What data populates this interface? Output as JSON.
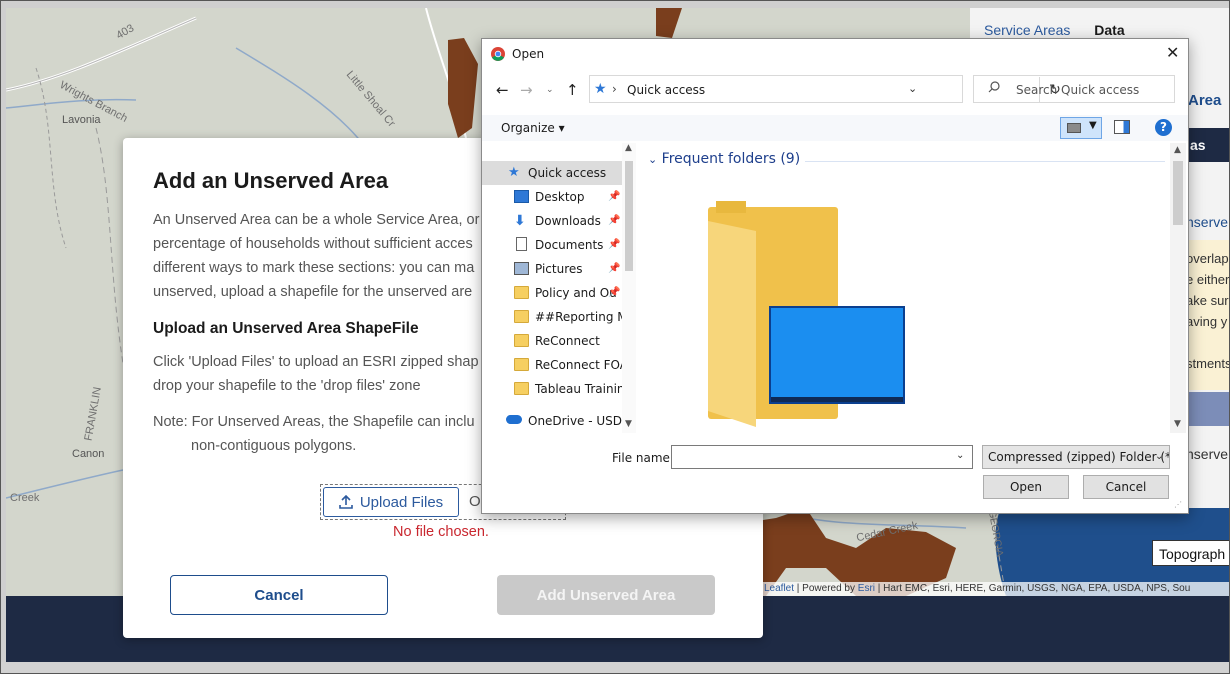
{
  "map": {
    "labels": {
      "route": "403",
      "wrights_branch": "Wrights Branch",
      "little_shoal": "Little Shoal Cr",
      "lavonia": "Lavonia",
      "franklin": "FRANKLIN",
      "canon": "Canon",
      "creek": "Creek",
      "cedar_creek": "Cedar Creek",
      "georgia": "GEORGIA"
    },
    "layer_select": "Topograph",
    "attribution": {
      "leaflet": "Leaflet",
      "powered": " | Powered by ",
      "esri": "Esri",
      "rest": " | Hart EMC, Esri, HERE, Garmin, USGS, NGA, EPA, USDA, NPS, Sou"
    },
    "colors": {
      "service_area": "#7a3e1d",
      "land": "#d3d6cc",
      "water": "#1f4f8c"
    }
  },
  "side_panel": {
    "tabs": [
      "Service Areas",
      "Data"
    ],
    "area_title": "Area",
    "dark_bar": "as",
    "unserved_1": "nserve",
    "yellow_lines": [
      "overlap",
      "e either",
      "ake sur",
      "aving y",
      "",
      "stments"
    ],
    "unserved_2": "nserve"
  },
  "modal": {
    "title": "Add an Unserved Area",
    "description": [
      "An Unserved Area can be a whole Service Area, or",
      "percentage of households without sufficient acces",
      "different ways to mark these sections: you can ma",
      "unserved, upload a shapefile for the unserved are"
    ],
    "subheading": "Upload an Unserved Area ShapeFile",
    "instructions": [
      "Click 'Upload Files' to upload an ESRI zipped shap",
      "drop your shapefile to the 'drop files' zone"
    ],
    "note": [
      "Note: For Unserved Areas, the Shapefile can inclu",
      "non-contiguous polygons."
    ],
    "upload_label": "Upload Files",
    "or_text": "O",
    "no_file": "No file chosen.",
    "cancel_label": "Cancel",
    "add_label": "Add Unserved Area"
  },
  "open_dialog": {
    "title": "Open",
    "close": "✕",
    "address": "Quick access",
    "search_placeholder": "Search Quick access",
    "organize": "Organize ▾",
    "help": "?",
    "nav_items": [
      {
        "label": "Quick access",
        "icon": "star-icon",
        "pinned": false,
        "selected": true
      },
      {
        "label": "Desktop",
        "icon": "desktop-icon",
        "pinned": true
      },
      {
        "label": "Downloads",
        "icon": "download-icon",
        "pinned": true
      },
      {
        "label": "Documents",
        "icon": "document-icon",
        "pinned": true
      },
      {
        "label": "Pictures",
        "icon": "pictures-icon",
        "pinned": true
      },
      {
        "label": "Policy and Ou",
        "icon": "folder-icon",
        "pinned": true
      },
      {
        "label": "##Reporting Ma",
        "icon": "folder-icon",
        "pinned": false
      },
      {
        "label": "ReConnect",
        "icon": "folder-icon",
        "pinned": false
      },
      {
        "label": "ReConnect FOA",
        "icon": "folder-icon",
        "pinned": false
      },
      {
        "label": "Tableau Training",
        "icon": "folder-icon",
        "pinned": false
      },
      {
        "label": "OneDrive - USDA",
        "icon": "cloud-icon",
        "pinned": false
      }
    ],
    "frequent_header": "Frequent folders (9)",
    "filename_label": "File name:",
    "filename_value": "",
    "filetype": "Compressed (zipped) Folder (*.",
    "open_label": "Open",
    "cancel_label": "Cancel"
  }
}
